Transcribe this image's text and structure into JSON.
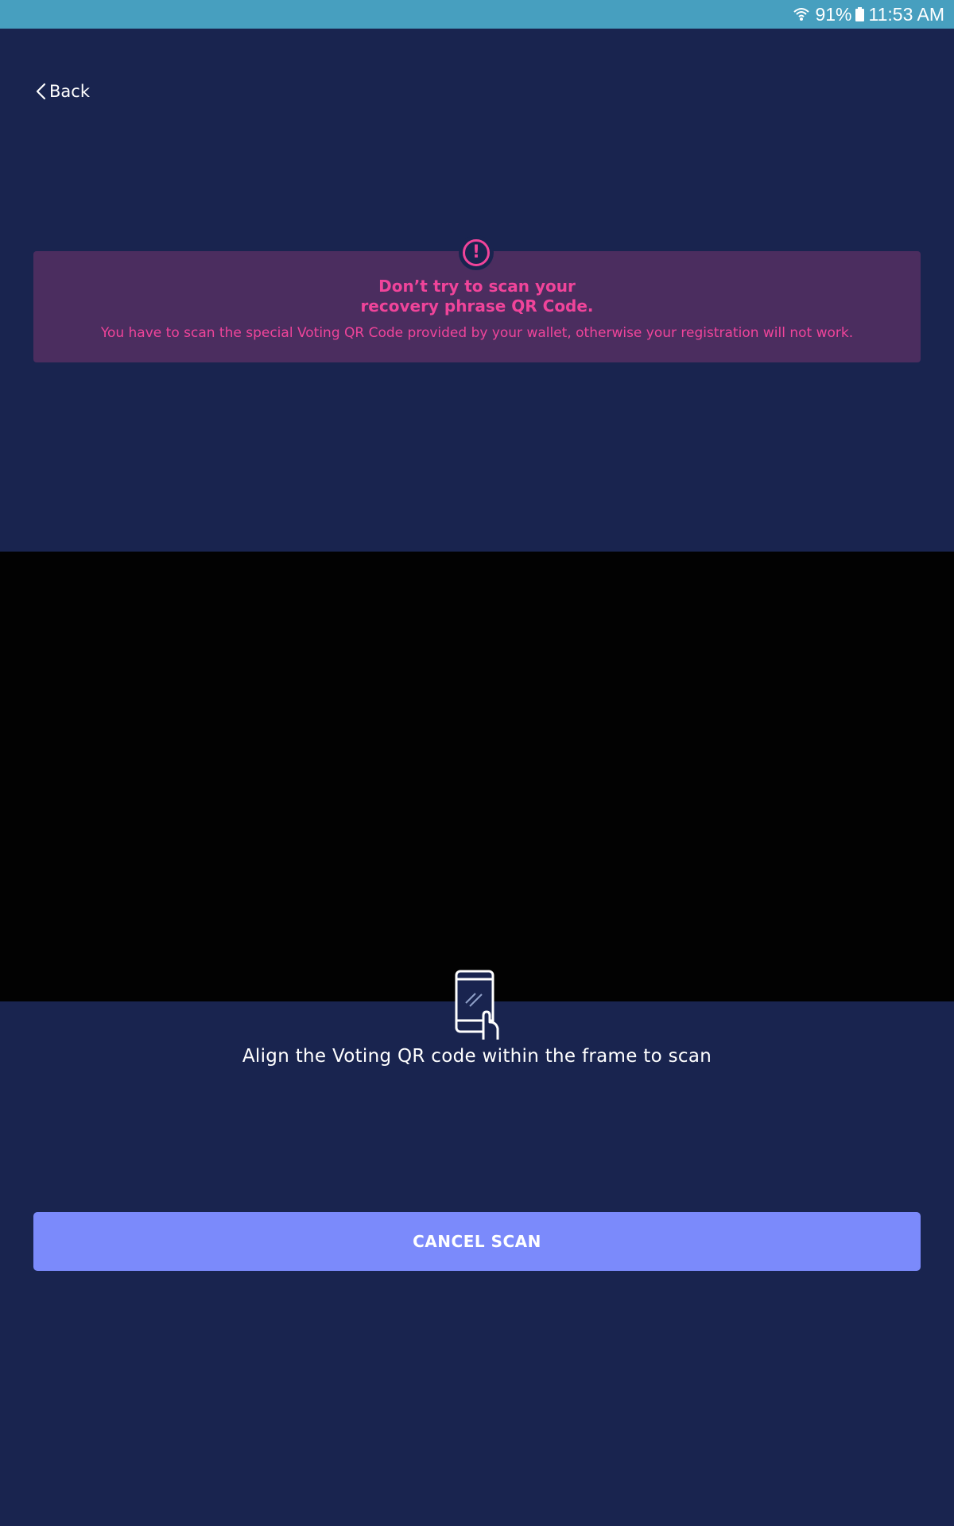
{
  "status_bar": {
    "battery_percent": "91%",
    "time": "11:53 AM",
    "icons": [
      "wifi-icon",
      "battery-icon"
    ]
  },
  "header": {
    "back_label": "Back"
  },
  "warning": {
    "icon": "exclamation-icon",
    "title": "Don’t try to scan your\nrecovery phrase QR Code.",
    "text": "You have to scan the special Voting QR Code provided by your wallet, otherwise your registration will not work."
  },
  "scanner": {
    "icon": "phone-scan-icon",
    "instruction": "Align the Voting QR code within the frame to scan"
  },
  "actions": {
    "cancel_label": "CANCEL SCAN"
  },
  "colors": {
    "background": "#19244f",
    "status_bar": "#479fbf",
    "warning_bg": "#4b2d5f",
    "warning_text": "#f0449a",
    "button": "#7b8afb"
  }
}
